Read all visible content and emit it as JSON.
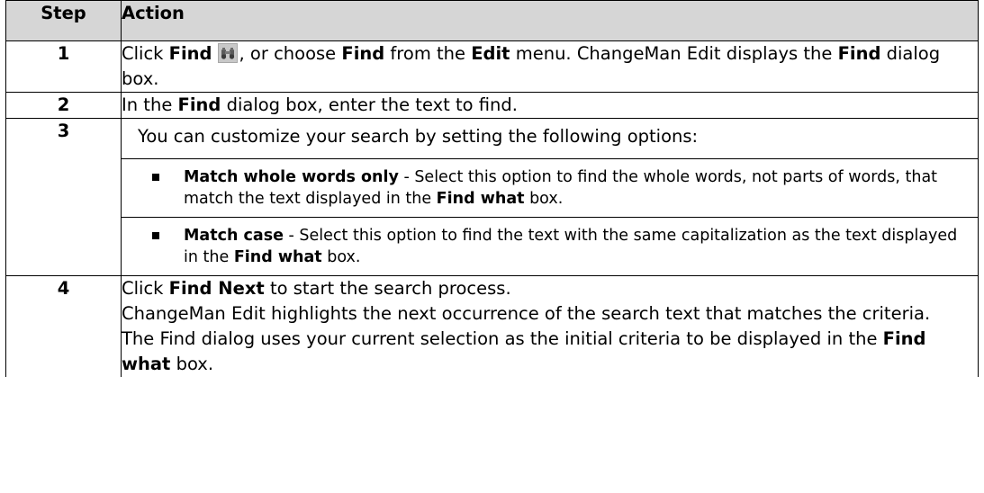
{
  "table": {
    "header": {
      "step": "Step",
      "action": "Action"
    },
    "rows": [
      {
        "step": "1",
        "segments": [
          "Click ",
          "Find",
          ", or choose ",
          "Find",
          " from the ",
          "Edit",
          " menu. ChangeMan Edit displays the ",
          "Find",
          " dialog box."
        ],
        "icon": "find-binoculars-icon"
      },
      {
        "step": "2",
        "segments": [
          "In the ",
          "Find",
          " dialog box, enter the text to find."
        ]
      },
      {
        "step": "3",
        "intro": "You can customize your search by setting the following options:",
        "options": [
          {
            "name": "Match whole words only",
            "desc_a": " - Select this option to find the whole words, not parts of words, that match the text displayed in the ",
            "ref": "Find what",
            "desc_b": " box."
          },
          {
            "name": "Match case",
            "desc_a": " - Select this option to find the text with the same capitalization as the text displayed in the ",
            "ref": "Find what",
            "desc_b": " box."
          }
        ]
      },
      {
        "step": "4",
        "line1": [
          "Click ",
          "Find Next",
          " to start the search process."
        ],
        "line2": "ChangeMan Edit highlights the next occurrence of the search text that matches the criteria.",
        "line3": [
          "The Find dialog uses your current selection as the initial criteria to be displayed in the ",
          "Find what",
          " box."
        ]
      }
    ]
  },
  "colors": {
    "header_bg": "#d6d6d6",
    "border": "#000000",
    "icon_bg": "#c8c8c8"
  }
}
